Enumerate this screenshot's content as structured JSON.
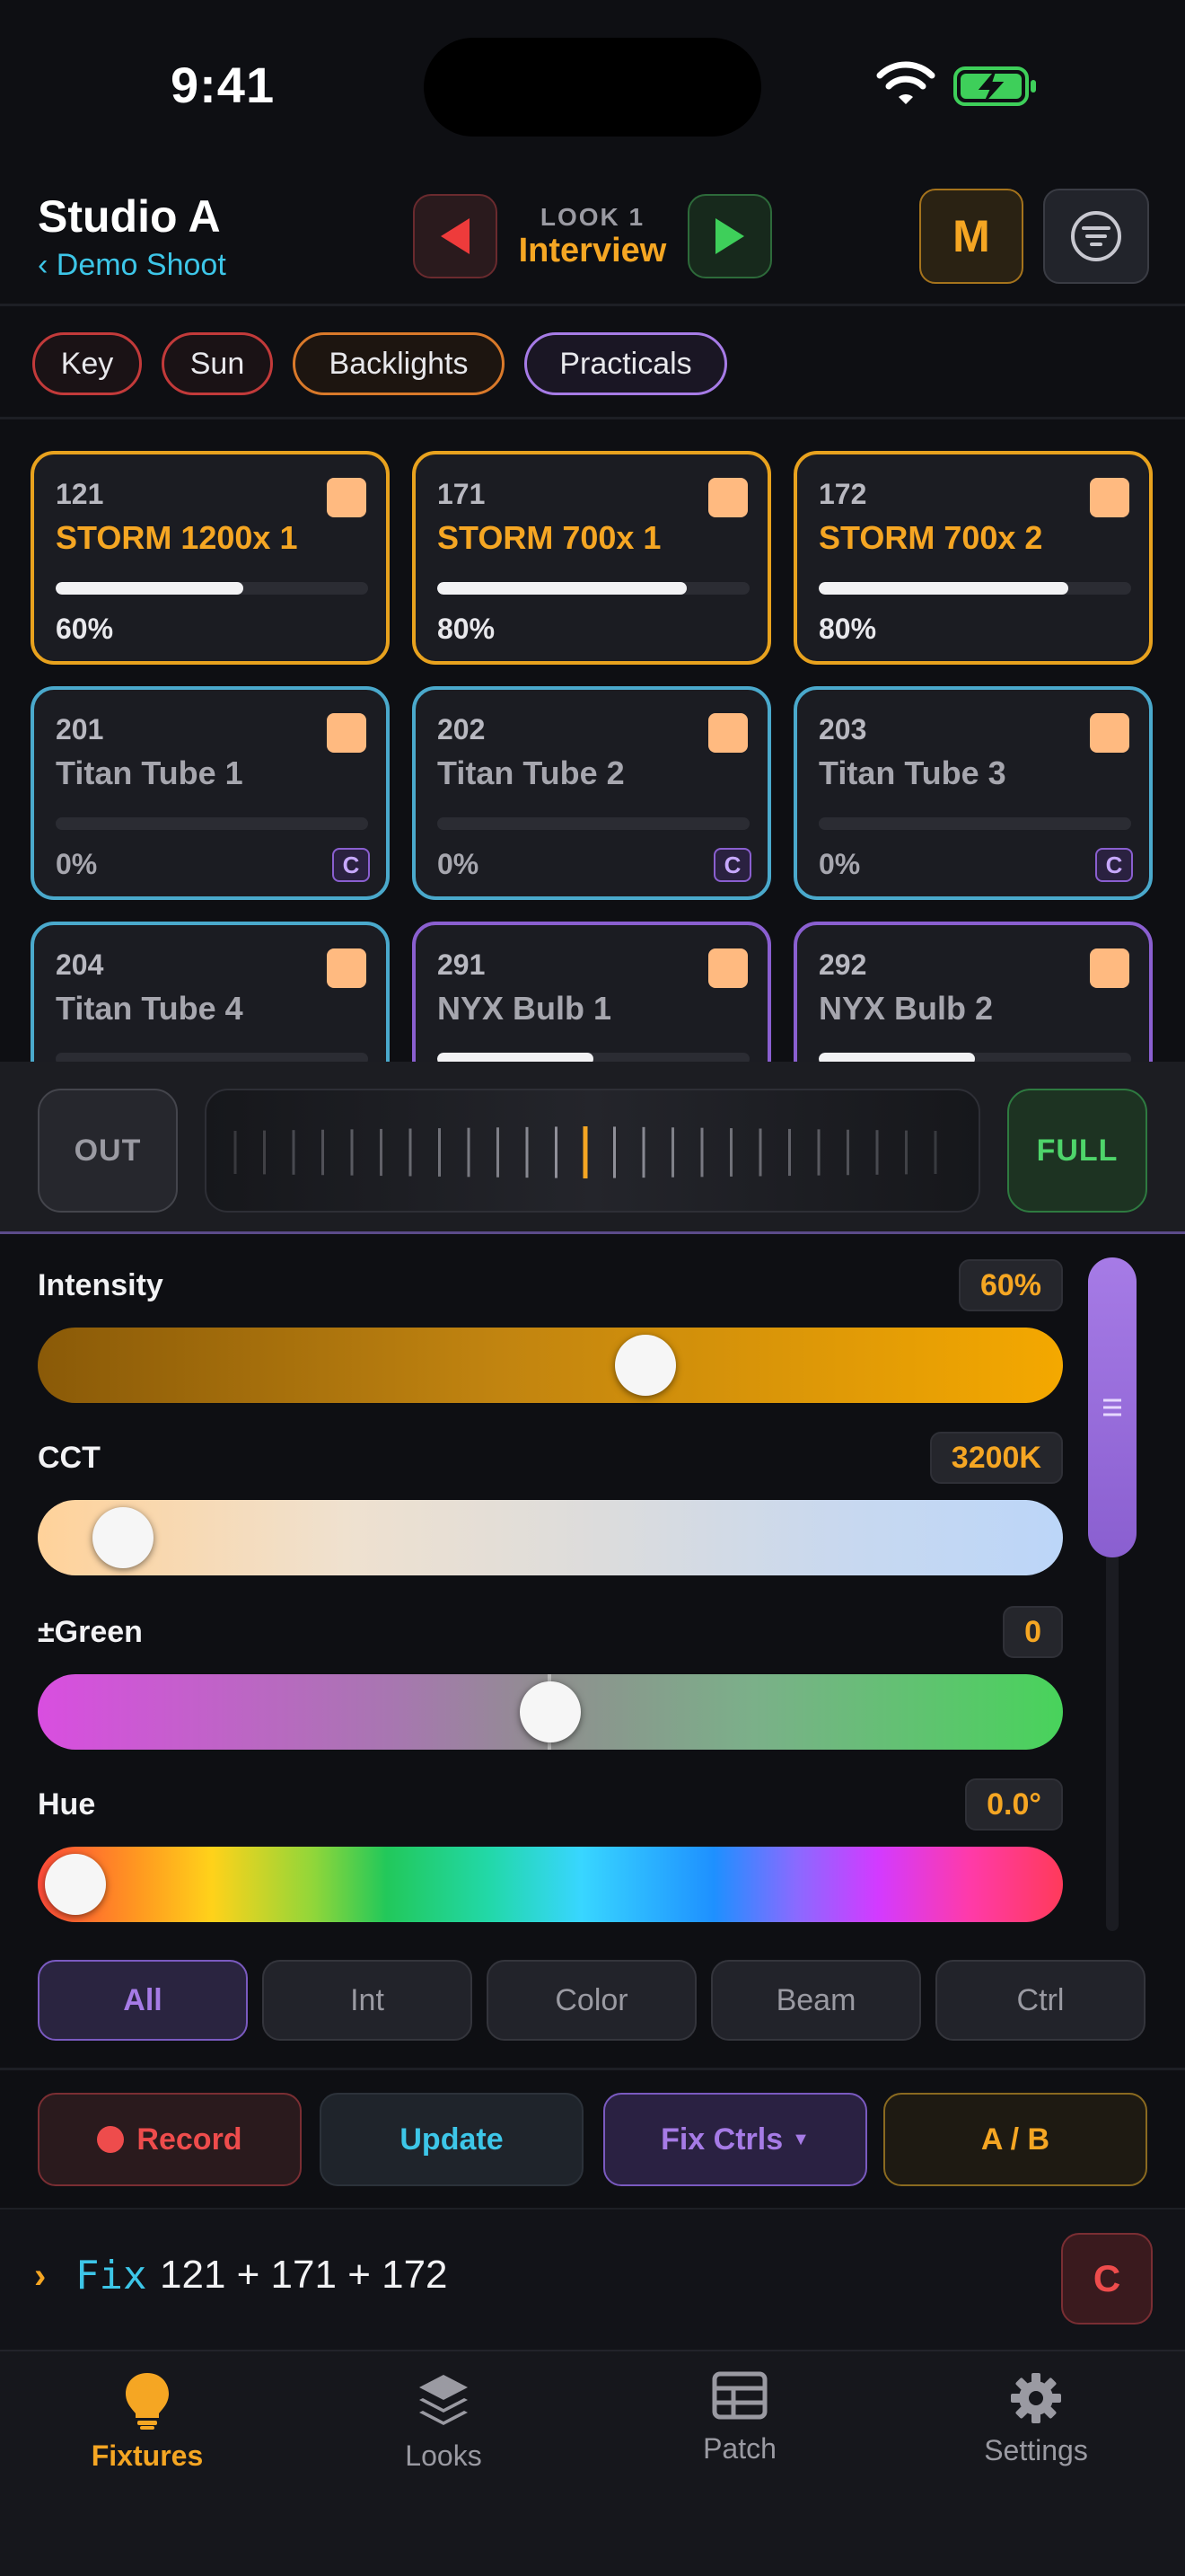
{
  "status": {
    "time": "9:41"
  },
  "header": {
    "title": "Studio A",
    "back_label": "‹ Demo Shoot",
    "look_label": "LOOK 1",
    "look_name": "Interview",
    "mode_label": "M"
  },
  "groups": [
    "Key",
    "Sun",
    "Backlights",
    "Practicals"
  ],
  "fixtures": [
    {
      "num": "121",
      "name": "STORM 1200x 1",
      "level": 0.6,
      "pct": "60%",
      "type": "gold",
      "badge": ""
    },
    {
      "num": "171",
      "name": "STORM 700x 1",
      "level": 0.8,
      "pct": "80%",
      "type": "gold",
      "badge": ""
    },
    {
      "num": "172",
      "name": "STORM 700x 2",
      "level": 0.8,
      "pct": "80%",
      "type": "gold",
      "badge": ""
    },
    {
      "num": "201",
      "name": "Titan Tube 1",
      "level": 0,
      "pct": "0%",
      "type": "cyan",
      "badge": "C"
    },
    {
      "num": "202",
      "name": "Titan Tube 2",
      "level": 0,
      "pct": "0%",
      "type": "cyan",
      "badge": "C"
    },
    {
      "num": "203",
      "name": "Titan Tube 3",
      "level": 0,
      "pct": "0%",
      "type": "cyan",
      "badge": "C"
    },
    {
      "num": "204",
      "name": "Titan Tube 4",
      "level": 0,
      "pct": "",
      "type": "cyan",
      "badge": ""
    },
    {
      "num": "291",
      "name": "NYX Bulb 1",
      "level": 0.5,
      "pct": "",
      "type": "purple",
      "badge": ""
    },
    {
      "num": "292",
      "name": "NYX Bulb 2",
      "level": 0.5,
      "pct": "",
      "type": "purple",
      "badge": ""
    }
  ],
  "fader": {
    "out_label": "OUT",
    "full_label": "FULL"
  },
  "params": {
    "intensity": {
      "label": "Intensity",
      "value": "60%",
      "position": 0.6
    },
    "cct": {
      "label": "CCT",
      "value": "3200K",
      "position": 0.05
    },
    "green": {
      "label": "±Green",
      "value": "0",
      "position": 0.5
    },
    "hue": {
      "label": "Hue",
      "value": "0.0°",
      "position": 0.0
    }
  },
  "filter_tabs": [
    "All",
    "Int",
    "Color",
    "Beam",
    "Ctrl"
  ],
  "actions": {
    "record": "Record",
    "update": "Update",
    "fix_ctrls": "Fix Ctrls",
    "ab": "A / B"
  },
  "command": {
    "caret": "›",
    "keyword": "Fix",
    "text": "121 + 171 + 172",
    "clear": "C"
  },
  "tabs": [
    {
      "label": "Fixtures",
      "icon": "bulb-icon"
    },
    {
      "label": "Looks",
      "icon": "layers-icon"
    },
    {
      "label": "Patch",
      "icon": "grid-icon"
    },
    {
      "label": "Settings",
      "icon": "gear-icon"
    }
  ],
  "colors": {
    "accent": "#f5a623",
    "cyan": "#3dc6e8",
    "purple": "#a67be6",
    "red": "#ee4c4c",
    "green": "#4ed56a"
  }
}
